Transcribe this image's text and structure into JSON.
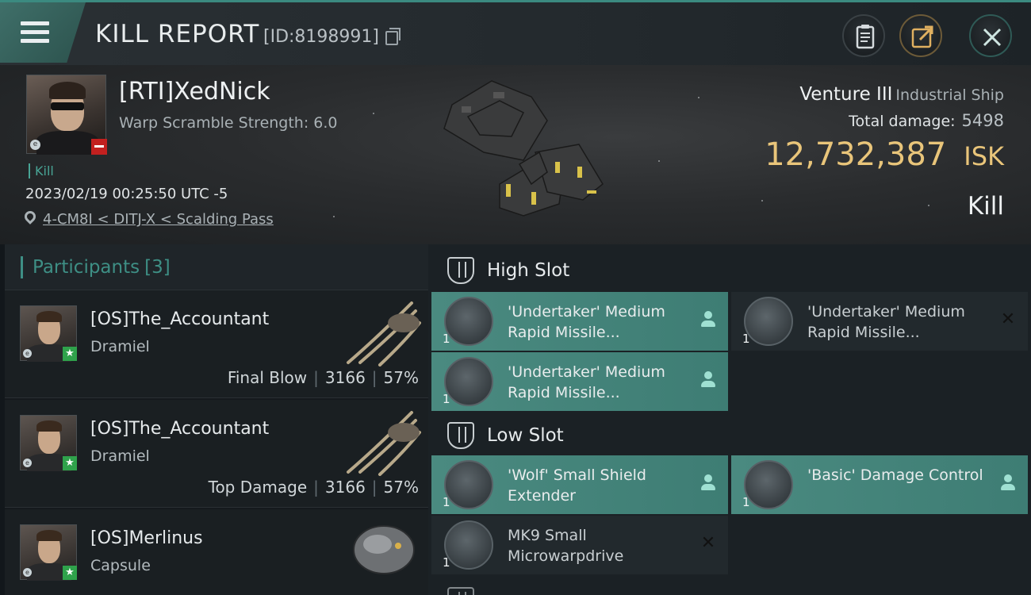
{
  "header": {
    "title": "KILL REPORT",
    "report_id": "[ID:8198991]",
    "menu_icon": "hamburger-icon",
    "actions": [
      "clipboard-icon",
      "share-icon",
      "close-icon"
    ]
  },
  "victim": {
    "name": "[RTI]XedNick",
    "warp_scramble": "Warp Scramble Strength: 6.0",
    "kill_tag": "Kill",
    "timestamp": "2023/02/19 00:25:50 UTC -5",
    "location": "4-CM8I < DITJ-X < Scalding Pass",
    "ship_name": "Venture III",
    "ship_class": "Industrial Ship",
    "total_damage_label": "Total damage:",
    "total_damage_value": "5498",
    "isk_value": "12,732,387",
    "isk_unit": "ISK",
    "result": "Kill"
  },
  "participants": {
    "label": "Participants",
    "count": "[3]",
    "items": [
      {
        "name": "[OS]The_Accountant",
        "ship": "Dramiel",
        "role": "Final Blow",
        "damage": "3166",
        "percent": "57%"
      },
      {
        "name": "[OS]The_Accountant",
        "ship": "Dramiel",
        "role": "Top Damage",
        "damage": "3166",
        "percent": "57%"
      },
      {
        "name": "[OS]Merlinus",
        "ship": "Capsule"
      }
    ]
  },
  "slots": {
    "high": {
      "label": "High Slot",
      "modules": [
        {
          "name": "'Undertaker' Medium Rapid Missile...",
          "qty": "1",
          "state": "fitted"
        },
        {
          "name": "'Undertaker' Medium Rapid Missile...",
          "qty": "1",
          "state": "destroyed"
        },
        {
          "name": "'Undertaker' Medium Rapid Missile...",
          "qty": "1",
          "state": "fitted"
        }
      ]
    },
    "low": {
      "label": "Low Slot",
      "modules": [
        {
          "name": "'Wolf' Small Shield Extender",
          "qty": "1",
          "state": "fitted"
        },
        {
          "name": "'Basic' Damage Control",
          "qty": "1",
          "state": "fitted"
        },
        {
          "name": "MK9 Small Microwarpdrive",
          "qty": "1",
          "state": "destroyed"
        }
      ]
    }
  },
  "colors": {
    "accent_teal": "#3e8f85",
    "isk_gold": "#e9c57a",
    "fitted_module": "#4a8a80",
    "destroyed_module": "#22292d"
  }
}
